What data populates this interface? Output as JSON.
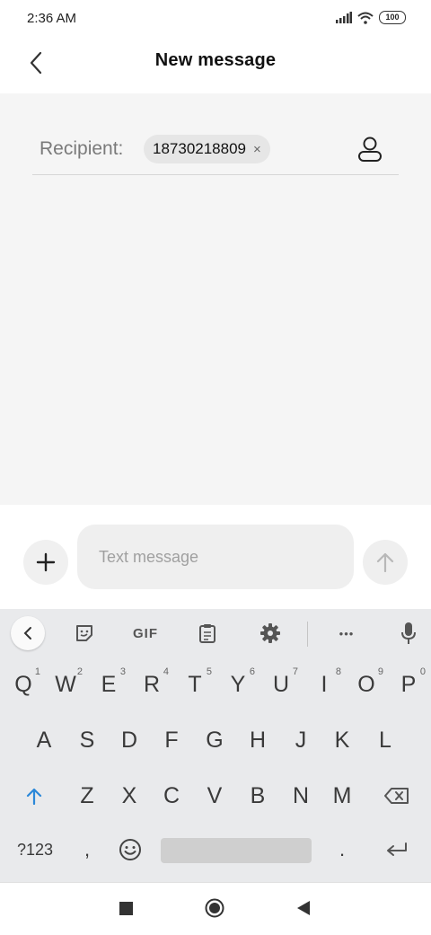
{
  "status_bar": {
    "time": "2:36 AM",
    "battery": "100"
  },
  "header": {
    "title": "New message"
  },
  "recipient": {
    "label": "Recipient:",
    "chip_value": "18730218809",
    "chip_remove": "×"
  },
  "compose": {
    "placeholder": "Text message"
  },
  "keyboard": {
    "toolbar": {
      "gif_label": "GIF",
      "more_label": "•••"
    },
    "row1": [
      {
        "key": "Q",
        "hint": "1"
      },
      {
        "key": "W",
        "hint": "2"
      },
      {
        "key": "E",
        "hint": "3"
      },
      {
        "key": "R",
        "hint": "4"
      },
      {
        "key": "T",
        "hint": "5"
      },
      {
        "key": "Y",
        "hint": "6"
      },
      {
        "key": "U",
        "hint": "7"
      },
      {
        "key": "I",
        "hint": "8"
      },
      {
        "key": "O",
        "hint": "9"
      },
      {
        "key": "P",
        "hint": "0"
      }
    ],
    "row2": [
      "A",
      "S",
      "D",
      "F",
      "G",
      "H",
      "J",
      "K",
      "L"
    ],
    "row3": [
      "Z",
      "X",
      "C",
      "V",
      "B",
      "N",
      "M"
    ],
    "row4": {
      "symbols": "?123",
      "comma": ",",
      "period": "."
    }
  }
}
